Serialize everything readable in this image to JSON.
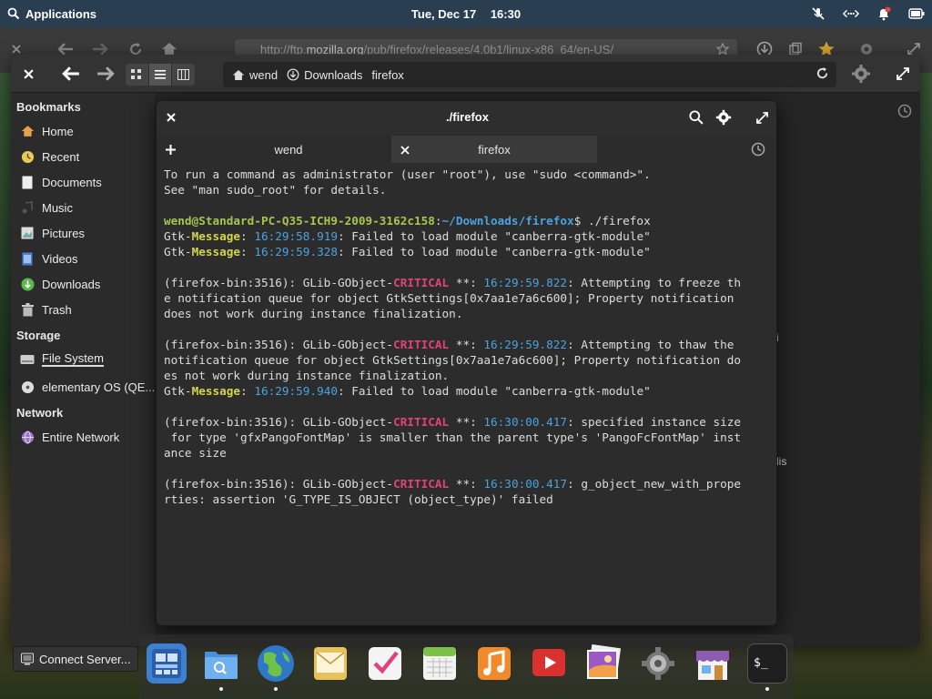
{
  "top_panel": {
    "applications_label": "Applications",
    "date": "Tue, Dec 17",
    "time": "16:30"
  },
  "browser": {
    "url_prefix": "http://ftp.",
    "url_domain": "mozilla.org",
    "url_suffix": "/pub/firefox/releases/4.0b1/linux-x86_64/en-US/"
  },
  "files": {
    "pathbar": {
      "crumbs": [
        "wend",
        "Downloads",
        "firefox"
      ]
    },
    "sidebar": {
      "bookmarks_heading": "Bookmarks",
      "bookmarks": [
        {
          "label": "Home",
          "icon": "home-icon"
        },
        {
          "label": "Recent",
          "icon": "recent-icon"
        },
        {
          "label": "Documents",
          "icon": "documents-icon"
        },
        {
          "label": "Music",
          "icon": "music-icon"
        },
        {
          "label": "Pictures",
          "icon": "pictures-icon"
        },
        {
          "label": "Videos",
          "icon": "videos-icon"
        },
        {
          "label": "Downloads",
          "icon": "downloads-icon"
        },
        {
          "label": "Trash",
          "icon": "trash-icon"
        }
      ],
      "storage_heading": "Storage",
      "storage": [
        {
          "label": "File System",
          "icon": "drive-icon"
        },
        {
          "label": "elementary OS (QE...",
          "icon": "disc-icon"
        }
      ],
      "network_heading": "Network",
      "network": [
        {
          "label": "Entire Network",
          "icon": "network-icon"
        }
      ]
    },
    "content_fragments": [
      "i",
      "lis"
    ]
  },
  "terminal": {
    "title": "./firefox",
    "tabs": [
      {
        "label": "wend"
      },
      {
        "label": "firefox"
      }
    ],
    "lines": {
      "l1": "To run a command as administrator (user \"root\"), use \"sudo <command>\".",
      "l2": "See \"man sudo_root\" for details.",
      "prompt_user": "wend@Standard-PC-Q35-ICH9-2009-3162c158",
      "prompt_colon": ":",
      "prompt_path": "~/Downloads/firefox",
      "prompt_cmd": "$ ./firefox",
      "gtk1_a": "Gtk-",
      "gtk1_b": "Message",
      "gtk1_c": ": ",
      "gtk1_t": "16:29:58.919",
      "gtk1_d": ": Failed to load module \"canberra-gtk-module\"",
      "gtk2_t": "16:29:59.328",
      "gtk_fail": ": Failed to load module \"canberra-gtk-module\"",
      "ff_prefix": "(firefox-bin:3516): GLib-GObject-",
      "critical": "CRITICAL",
      "stars": " **: ",
      "c1_t": "16:29:59.822",
      "c1_a": ": Attempting to freeze th",
      "c1_b": "e notification queue for object GtkSettings[0x7aa1e7a6c600]; Property notification",
      "c1_c": "does not work during instance finalization.",
      "c2_t": "16:29:59.822",
      "c2_a": ": Attempting to thaw the",
      "c2_b": "notification queue for object GtkSettings[0x7aa1e7a6c600]; Property notification do",
      "c2_c": "es not work during instance finalization.",
      "gtk3_t": "16:29:59.940",
      "c3_t": "16:30:00.417",
      "c3_a": ": specified instance size",
      "c3_b": " for type 'gfxPangoFontMap' is smaller than the parent type's 'PangoFcFontMap' inst",
      "c3_c": "ance size",
      "c4_t": "16:30:00.417",
      "c4_a": ": g_object_new_with_prope",
      "c4_b": "rties: assertion 'G_TYPE_IS_OBJECT (object_type)' failed"
    }
  },
  "connect_server": {
    "label": "Connect Server..."
  },
  "dock": {
    "items": [
      {
        "name": "multitasking-view",
        "color": "#3d7fd1"
      },
      {
        "name": "files",
        "color": "#5aa0e0"
      },
      {
        "name": "web-browser",
        "color": "#3c9e3c"
      },
      {
        "name": "mail",
        "color": "#e9c95a"
      },
      {
        "name": "tasks",
        "color": "#f0f0f0"
      },
      {
        "name": "calendar",
        "color": "#7cbf4a"
      },
      {
        "name": "music",
        "color": "#f08a2a"
      },
      {
        "name": "videos",
        "color": "#d93030"
      },
      {
        "name": "photos",
        "color": "#8e5bb5"
      },
      {
        "name": "system-settings",
        "color": "#666666"
      },
      {
        "name": "appcenter",
        "color": "#8d5cb0"
      },
      {
        "name": "terminal",
        "color": "#1e1e1e"
      }
    ]
  }
}
